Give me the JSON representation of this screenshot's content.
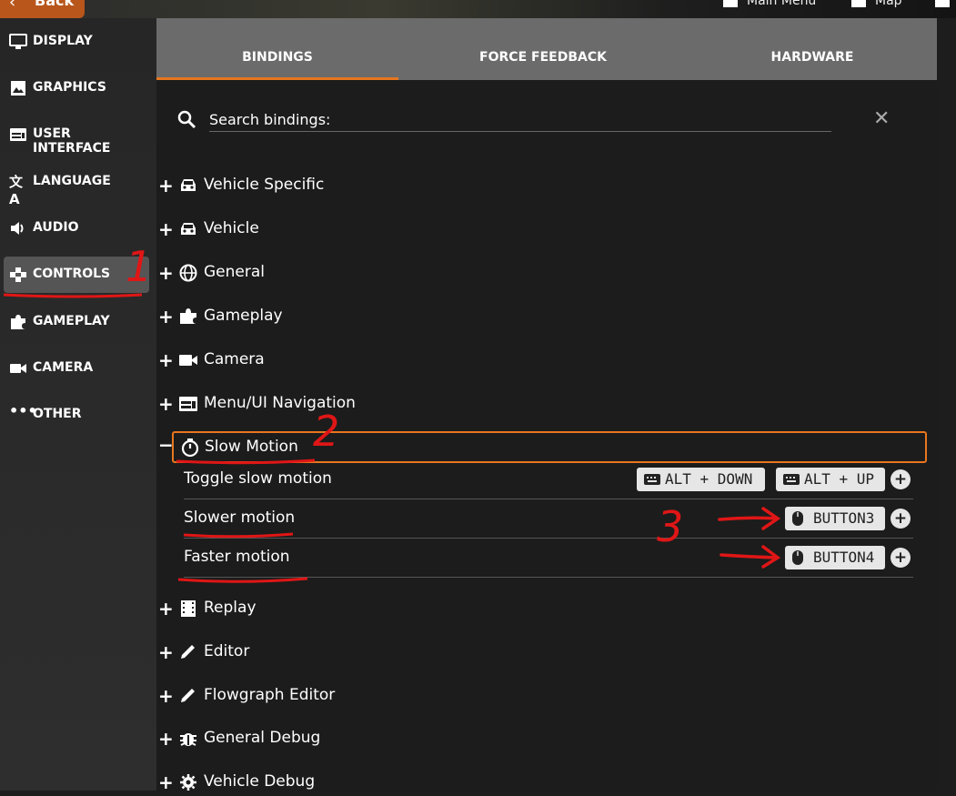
{
  "top": {
    "back_label": "Back",
    "main_menu_label": "Main Menu",
    "map_label": "Map"
  },
  "sidebar": {
    "items": [
      {
        "label": "DISPLAY",
        "icon": "monitor-icon"
      },
      {
        "label": "GRAPHICS",
        "icon": "image-icon"
      },
      {
        "label": "USER INTERFACE",
        "icon": "window-icon"
      },
      {
        "label": "LANGUAGE",
        "icon": "translate-icon"
      },
      {
        "label": "AUDIO",
        "icon": "speaker-icon"
      },
      {
        "label": "CONTROLS",
        "icon": "gamepad-icon",
        "active": true
      },
      {
        "label": "GAMEPLAY",
        "icon": "puzzle-icon"
      },
      {
        "label": "CAMERA",
        "icon": "camera-icon"
      },
      {
        "label": "OTHER",
        "icon": "ellipsis-icon"
      }
    ]
  },
  "tabs": [
    {
      "label": "BINDINGS",
      "active": true
    },
    {
      "label": "FORCE FEEDBACK"
    },
    {
      "label": "HARDWARE"
    }
  ],
  "search": {
    "placeholder": "Search bindings:"
  },
  "categories_before": [
    {
      "label": "Vehicle Specific",
      "icon": "car-icon",
      "toggle": "+"
    },
    {
      "label": "Vehicle",
      "icon": "car-icon",
      "toggle": "+"
    },
    {
      "label": "General",
      "icon": "globe-icon",
      "toggle": "+"
    },
    {
      "label": "Gameplay",
      "icon": "puzzle-icon",
      "toggle": "+"
    },
    {
      "label": "Camera",
      "icon": "video-camera-icon",
      "toggle": "+"
    },
    {
      "label": "Menu/UI Navigation",
      "icon": "window-icon",
      "toggle": "+"
    }
  ],
  "expanded": {
    "label": "Slow Motion",
    "toggle": "−",
    "icon": "stopwatch-icon",
    "bindings": [
      {
        "label": "Toggle slow motion",
        "keys": [
          {
            "device": "keyboard-icon",
            "text": "ALT + DOWN"
          },
          {
            "device": "keyboard-icon",
            "text": "ALT + UP"
          }
        ]
      },
      {
        "label": "Slower motion",
        "keys": [
          {
            "device": "mouse-icon",
            "text": "BUTTON3"
          }
        ]
      },
      {
        "label": "Faster motion",
        "keys": [
          {
            "device": "mouse-icon",
            "text": "BUTTON4"
          }
        ]
      }
    ],
    "add_label": "+"
  },
  "categories_after": [
    {
      "label": "Replay",
      "icon": "film-icon",
      "toggle": "+"
    },
    {
      "label": "Editor",
      "icon": "pencil-icon",
      "toggle": "+"
    },
    {
      "label": "Flowgraph Editor",
      "icon": "pencil-icon",
      "toggle": "+"
    },
    {
      "label": "General Debug",
      "icon": "bug-icon",
      "toggle": "+"
    },
    {
      "label": "Vehicle Debug",
      "icon": "gear-icon",
      "toggle": "+"
    }
  ],
  "annotations": {
    "n1": "1",
    "n2": "2",
    "n3": "3",
    "color": "#e01616"
  },
  "colors": {
    "accent": "#e8761f",
    "back_button": "#b8561c"
  }
}
